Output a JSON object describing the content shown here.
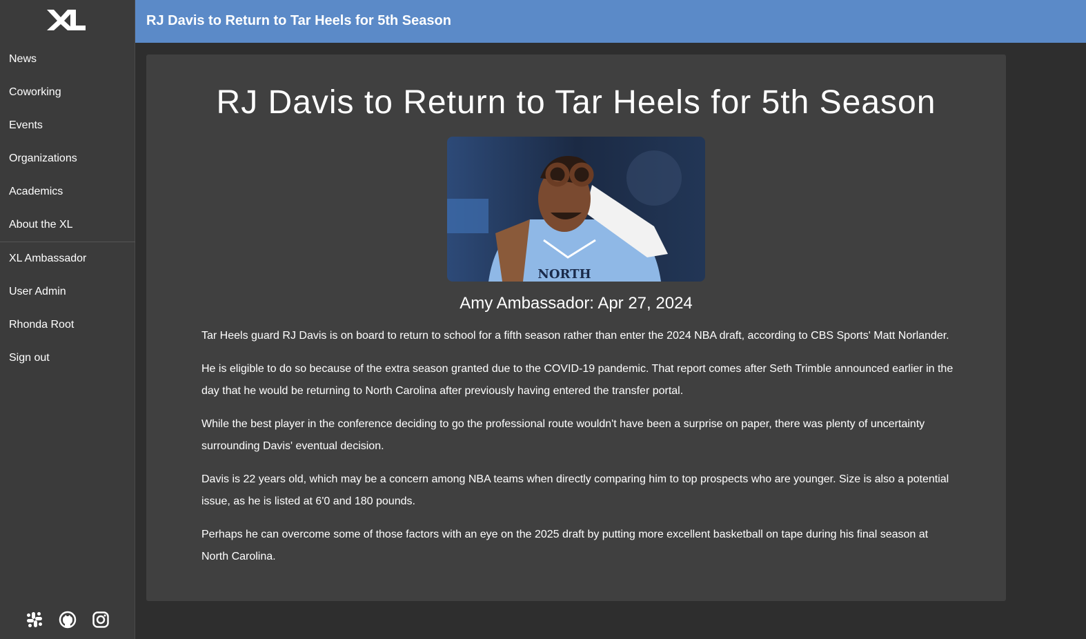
{
  "sidebar": {
    "logo_icon": "xl-logo-icon",
    "items": [
      {
        "label": "News"
      },
      {
        "label": "Coworking"
      },
      {
        "label": "Events"
      },
      {
        "label": "Organizations"
      },
      {
        "label": "Academics"
      },
      {
        "label": "About the XL"
      },
      {
        "label": "XL Ambassador"
      },
      {
        "label": "User Admin"
      },
      {
        "label": "Rhonda Root"
      },
      {
        "label": "Sign out"
      }
    ],
    "social_icons": [
      "slack-icon",
      "github-icon",
      "instagram-icon"
    ]
  },
  "header": {
    "title": "RJ Davis to Return to Tar Heels for 5th Season"
  },
  "article": {
    "title": "RJ Davis to Return to Tar Heels for 5th Season",
    "byline": "Amy Ambassador: Apr 27, 2024",
    "paragraphs": [
      "Tar Heels guard RJ Davis is on board to return to school for a fifth season rather than enter the 2024 NBA draft, according to CBS Sports' Matt Norlander.",
      "He is eligible to do so because of the extra season granted due to the COVID-19 pandemic. That report comes after Seth Trimble announced earlier in the day that he would be returning to North Carolina after previously having entered the transfer portal.",
      "While the best player in the conference deciding to go the professional route wouldn't have been a surprise on paper, there was plenty of uncertainty surrounding Davis' eventual decision.",
      "Davis is 22 years old, which may be a concern among NBA teams when directly comparing him to top prospects who are younger. Size is also a potential issue, as he is listed at 6'0 and 180 pounds.",
      "Perhaps he can overcome some of those factors with an eye on the 2025 draft by putting more excellent basketball on tape during his final season at North Carolina."
    ],
    "image_jersey_text": "NORTH"
  },
  "colors": {
    "topbar": "#5b8ac8",
    "sidebar": "#3b3b3b",
    "page": "#2e2e2e",
    "card": "#404040"
  }
}
